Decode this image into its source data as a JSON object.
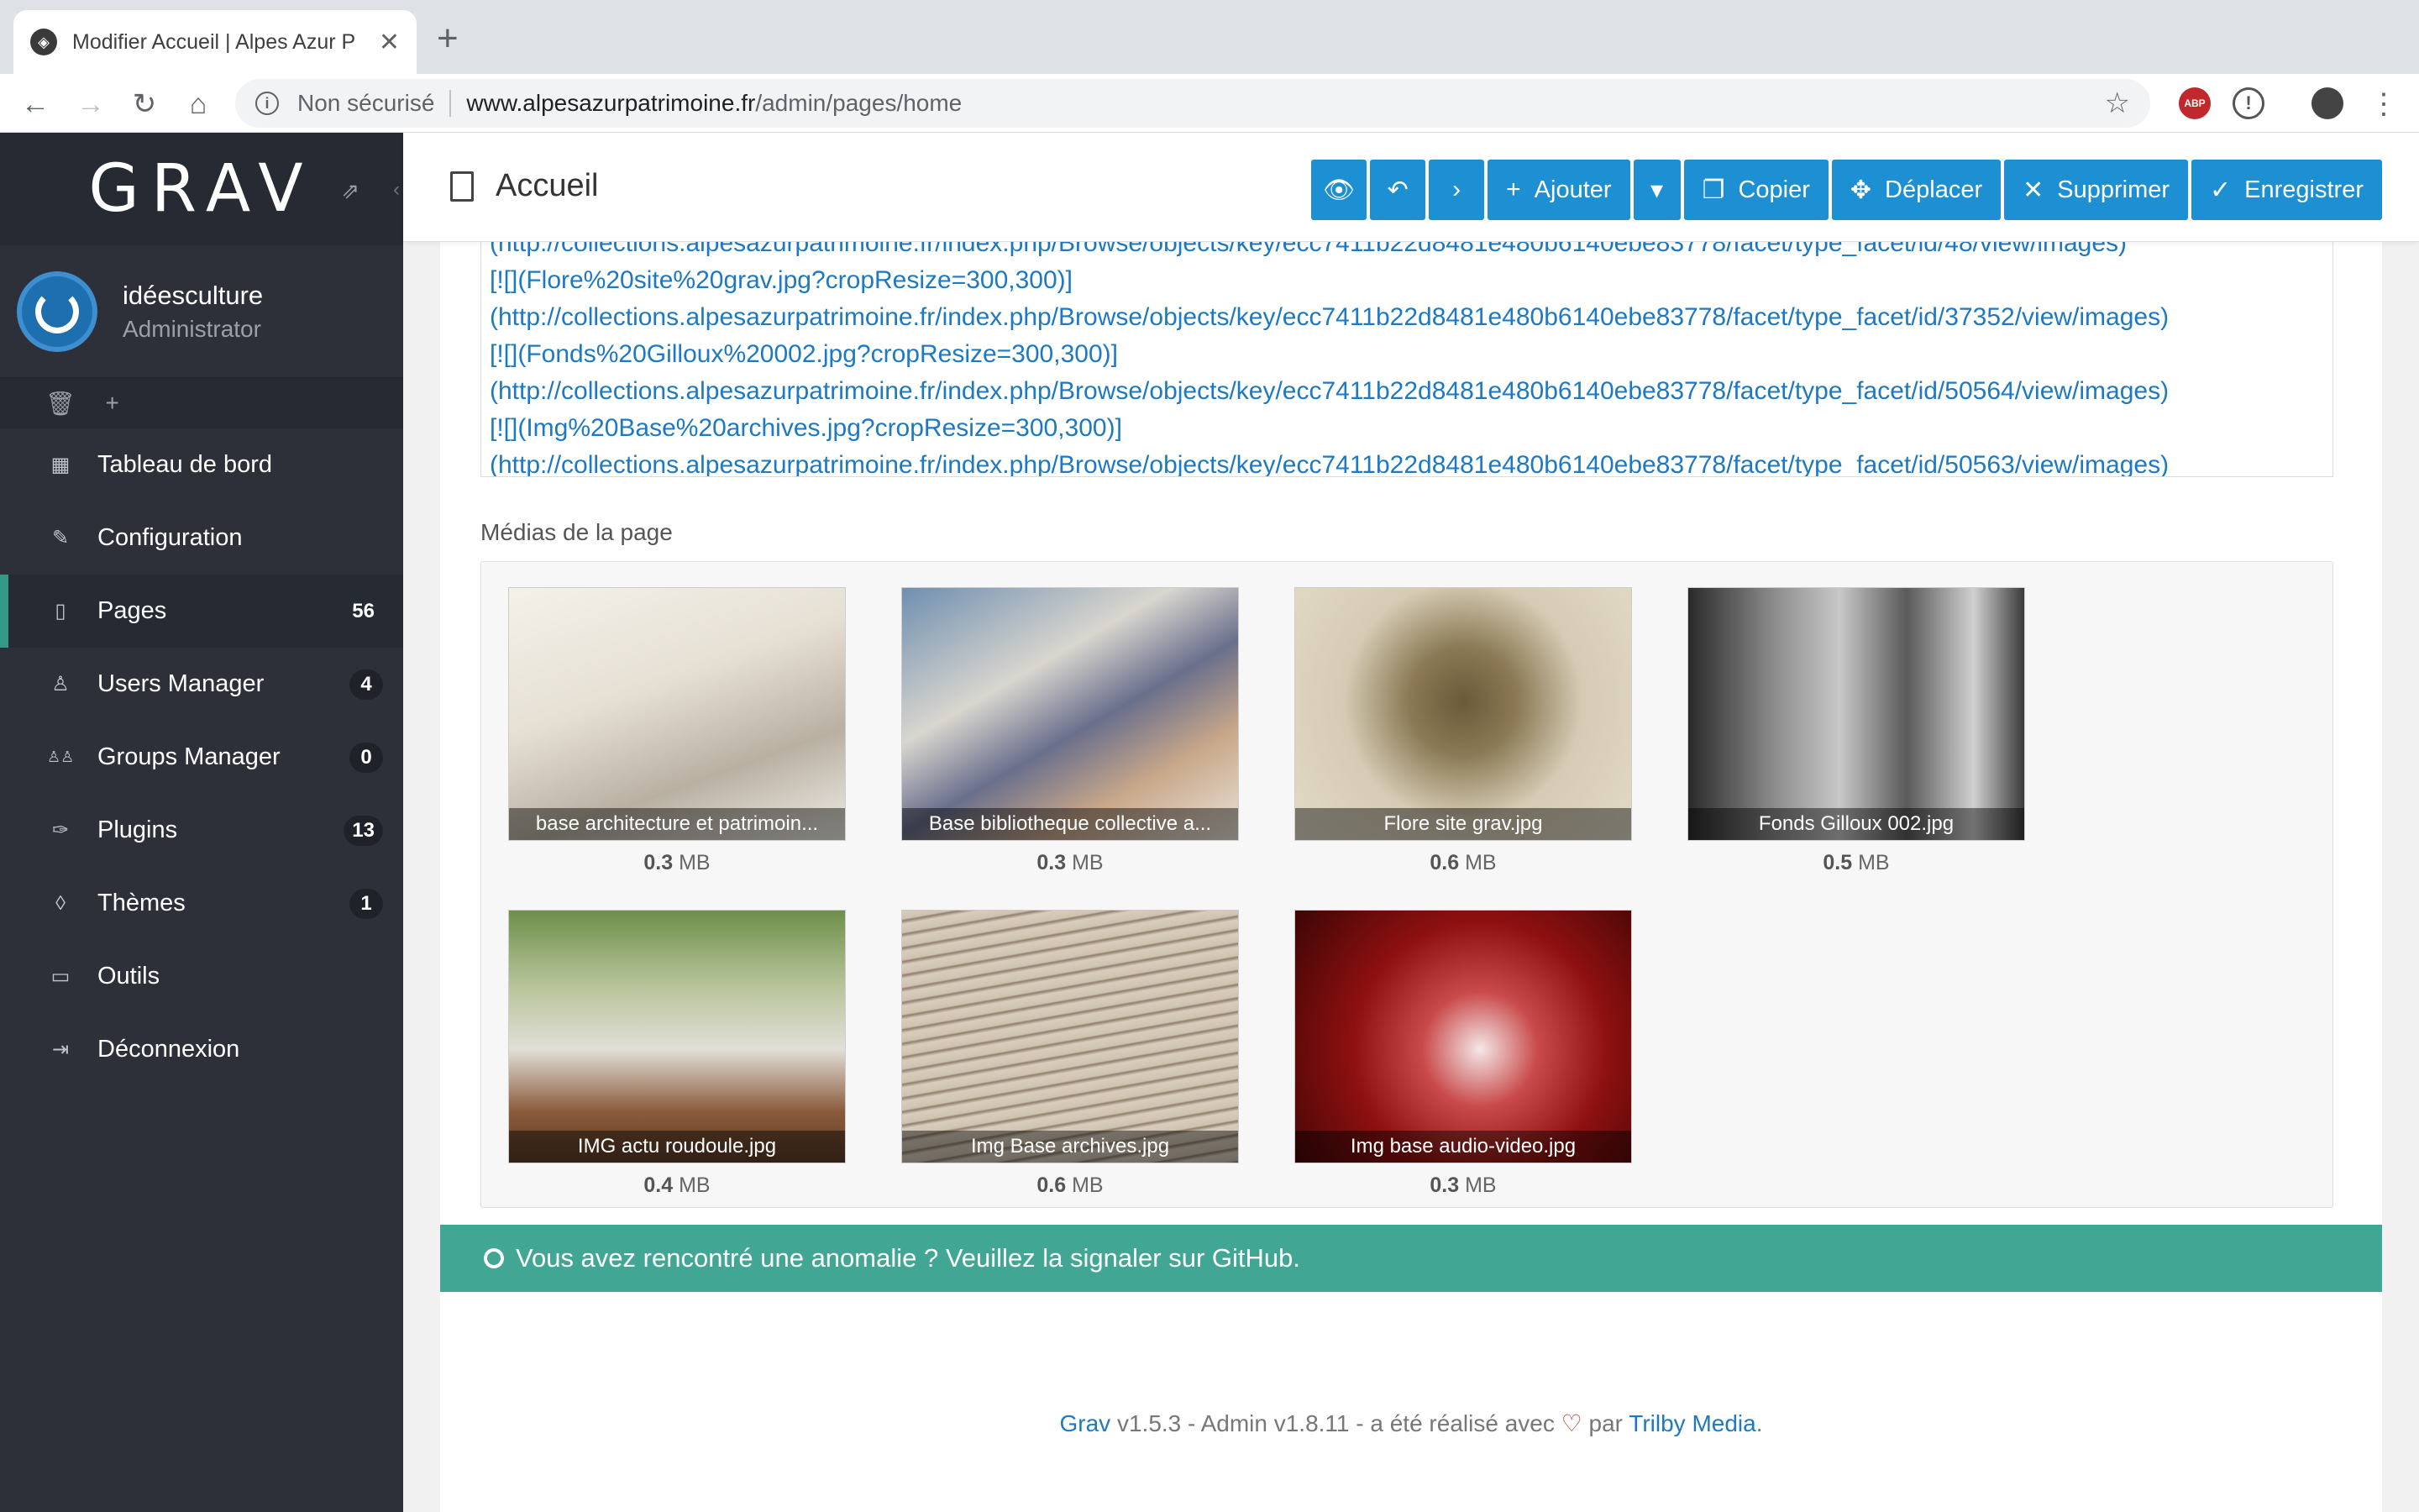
{
  "browser": {
    "tab_title": "Modifier Accueil | Alpes Azur P",
    "tab_close": "✕",
    "new_tab": "+",
    "security": "Non sécurisé",
    "url_host": "www.alpesazurpatrimoine.fr",
    "url_path": "/admin/pages/home",
    "ext_abp": "ABP"
  },
  "sidebar": {
    "logo": "GRAV",
    "user_name": "idéesculture",
    "user_role": "Administrator",
    "quick_icons": [
      "trash-icon",
      "plus-icon"
    ],
    "items": [
      {
        "label": "Tableau de bord",
        "icon": "▦",
        "badge": ""
      },
      {
        "label": "Configuration",
        "icon": "✎",
        "badge": ""
      },
      {
        "label": "Pages",
        "icon": "▯",
        "badge": "56",
        "active": true
      },
      {
        "label": "Users Manager",
        "icon": "♙",
        "badge": "4"
      },
      {
        "label": "Groups Manager",
        "icon": "♙♙",
        "badge": "0"
      },
      {
        "label": "Plugins",
        "icon": "✑",
        "badge": "13"
      },
      {
        "label": "Thèmes",
        "icon": "◊",
        "badge": "1"
      },
      {
        "label": "Outils",
        "icon": "▭",
        "badge": ""
      },
      {
        "label": "Déconnexion",
        "icon": "⇥",
        "badge": ""
      }
    ]
  },
  "header": {
    "title": "Accueil",
    "buttons": {
      "preview": "👁",
      "back": "↶",
      "next": "›",
      "add": "Ajouter",
      "dropdown": "▾",
      "copy": "Copier",
      "move": "Déplacer",
      "delete": "Supprimer",
      "save": "Enregistrer"
    }
  },
  "editor": {
    "lines": [
      "(http://collections.alpesazurpatrimoine.fr/index.php/Browse/objects/key/ecc7411b22d8481e480b6140ebe83778/facet/type_facet/id/48/view/images)",
      "[![](Flore%20site%20grav.jpg?cropResize=300,300)]",
      "(http://collections.alpesazurpatrimoine.fr/index.php/Browse/objects/key/ecc7411b22d8481e480b6140ebe83778/facet/type_facet/id/37352/view/images)",
      "[![](Fonds%20Gilloux%20002.jpg?cropResize=300,300)]",
      "(http://collections.alpesazurpatrimoine.fr/index.php/Browse/objects/key/ecc7411b22d8481e480b6140ebe83778/facet/type_facet/id/50564/view/images)",
      "[![](Img%20Base%20archives.jpg?cropResize=300,300)]",
      "(http://collections.alpesazurpatrimoine.fr/index.php/Browse/objects/key/ecc7411b22d8481e480b6140ebe83778/facet/type_facet/id/50563/view/images)"
    ]
  },
  "media": {
    "label": "Médias de la page",
    "unit": "MB",
    "items": [
      {
        "name": "base architecture et patrimoin...",
        "size": "0.3"
      },
      {
        "name": "Base bibliotheque collective a...",
        "size": "0.3"
      },
      {
        "name": "Flore site grav.jpg",
        "size": "0.6"
      },
      {
        "name": "Fonds Gilloux 002.jpg",
        "size": "0.5"
      },
      {
        "name": "IMG actu roudoule.jpg",
        "size": "0.4"
      },
      {
        "name": "Img Base archives.jpg",
        "size": "0.6"
      },
      {
        "name": "Img base audio-video.jpg",
        "size": "0.3"
      }
    ]
  },
  "alert": {
    "text": "Vous avez rencontré une anomalie ? Veuillez la signaler sur GitHub."
  },
  "footer": {
    "grav_link": "Grav",
    "text1": " v1.5.3 - Admin v1.8.11 - a été réalisé avec ",
    "heart": "♡",
    "text2": " par ",
    "trilby_link": "Trilby Media",
    "text3": "."
  },
  "colors": {
    "sidebar_bg": "#2d3039",
    "accent_blue": "#1d8fd3",
    "alert_teal": "#41a694",
    "link_blue": "#1d79c3"
  }
}
